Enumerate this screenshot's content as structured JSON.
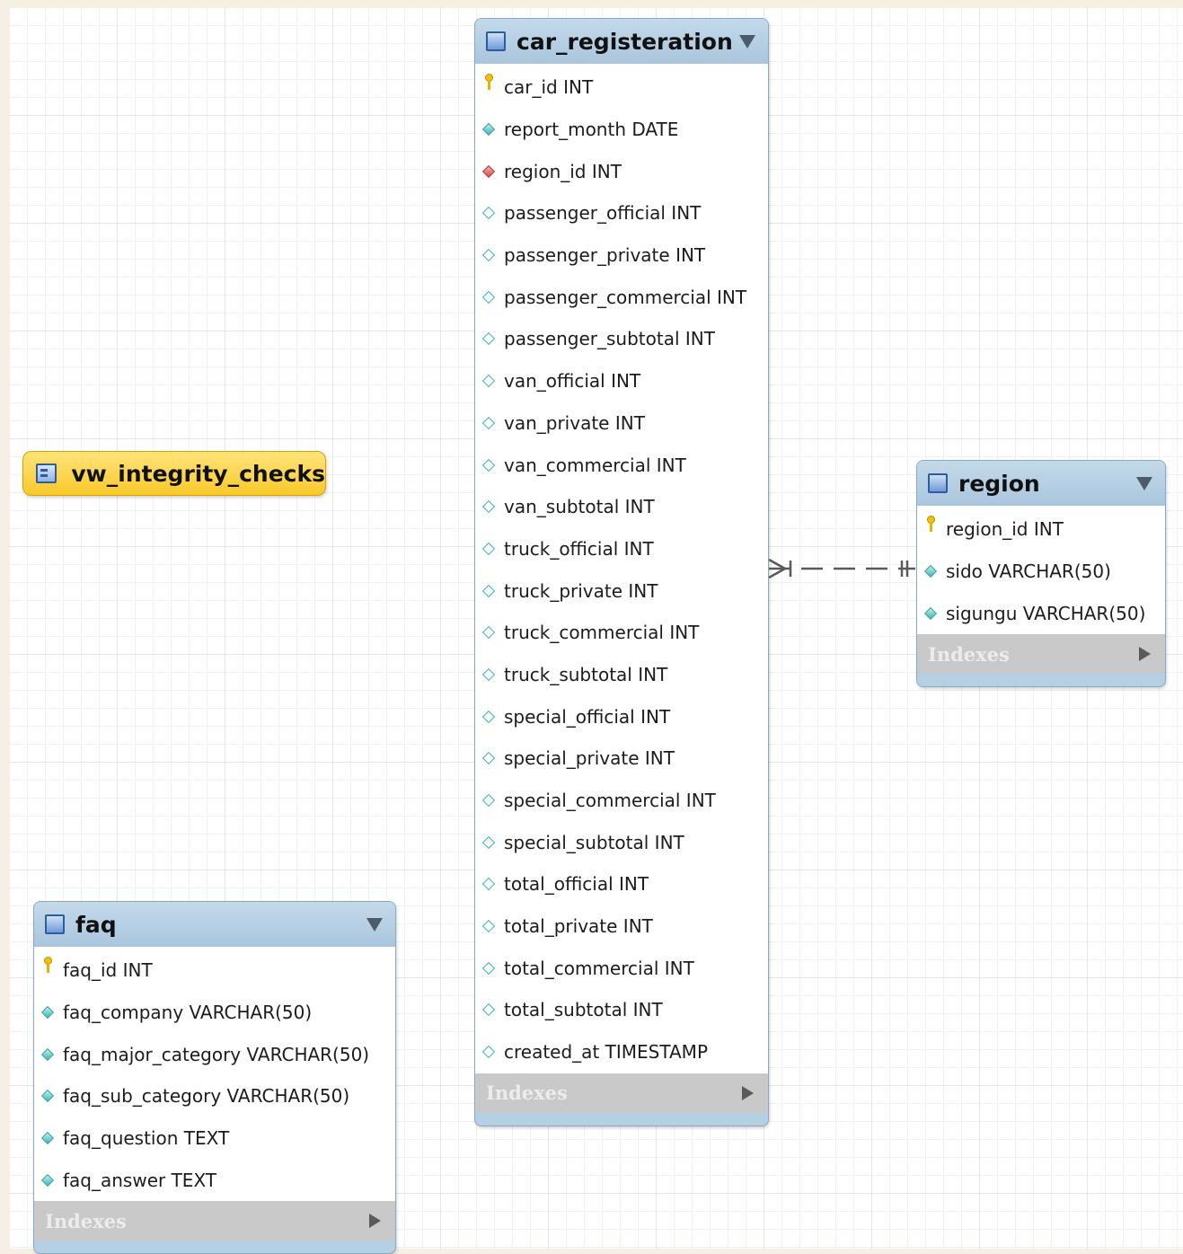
{
  "view": {
    "name": "vw_integrity_checks",
    "icon": "view-icon"
  },
  "tables": [
    {
      "id": "car_registeration",
      "name": "car_registeration",
      "columns": [
        {
          "kind": "pk",
          "label": "car_id INT"
        },
        {
          "kind": "nn",
          "label": "report_month DATE"
        },
        {
          "kind": "fk",
          "label": "region_id INT"
        },
        {
          "kind": "null",
          "label": "passenger_official INT"
        },
        {
          "kind": "null",
          "label": "passenger_private INT"
        },
        {
          "kind": "null",
          "label": "passenger_commercial INT"
        },
        {
          "kind": "null",
          "label": "passenger_subtotal INT"
        },
        {
          "kind": "null",
          "label": "van_official INT"
        },
        {
          "kind": "null",
          "label": "van_private INT"
        },
        {
          "kind": "null",
          "label": "van_commercial INT"
        },
        {
          "kind": "null",
          "label": "van_subtotal INT"
        },
        {
          "kind": "null",
          "label": "truck_official INT"
        },
        {
          "kind": "null",
          "label": "truck_private INT"
        },
        {
          "kind": "null",
          "label": "truck_commercial INT"
        },
        {
          "kind": "null",
          "label": "truck_subtotal INT"
        },
        {
          "kind": "null",
          "label": "special_official INT"
        },
        {
          "kind": "null",
          "label": "special_private INT"
        },
        {
          "kind": "null",
          "label": "special_commercial INT"
        },
        {
          "kind": "null",
          "label": "special_subtotal INT"
        },
        {
          "kind": "null",
          "label": "total_official INT"
        },
        {
          "kind": "null",
          "label": "total_private INT"
        },
        {
          "kind": "null",
          "label": "total_commercial INT"
        },
        {
          "kind": "null",
          "label": "total_subtotal INT"
        },
        {
          "kind": "null",
          "label": "created_at TIMESTAMP"
        }
      ],
      "indexes_label": "Indexes"
    },
    {
      "id": "region",
      "name": "region",
      "columns": [
        {
          "kind": "pk",
          "label": "region_id INT"
        },
        {
          "kind": "nn",
          "label": "sido VARCHAR(50)"
        },
        {
          "kind": "nn",
          "label": "sigungu VARCHAR(50)"
        }
      ],
      "indexes_label": "Indexes"
    },
    {
      "id": "faq",
      "name": "faq",
      "columns": [
        {
          "kind": "pk",
          "label": "faq_id INT"
        },
        {
          "kind": "nn",
          "label": "faq_company VARCHAR(50)"
        },
        {
          "kind": "nn",
          "label": "faq_major_category VARCHAR(50)"
        },
        {
          "kind": "nn",
          "label": "faq_sub_category VARCHAR(50)"
        },
        {
          "kind": "nn",
          "label": "faq_question TEXT"
        },
        {
          "kind": "nn",
          "label": "faq_answer TEXT"
        }
      ],
      "indexes_label": "Indexes"
    }
  ],
  "relationships": [
    {
      "from": "car_registeration",
      "to": "region",
      "from_cardinality": "many",
      "to_cardinality": "one",
      "identifying": false
    }
  ]
}
